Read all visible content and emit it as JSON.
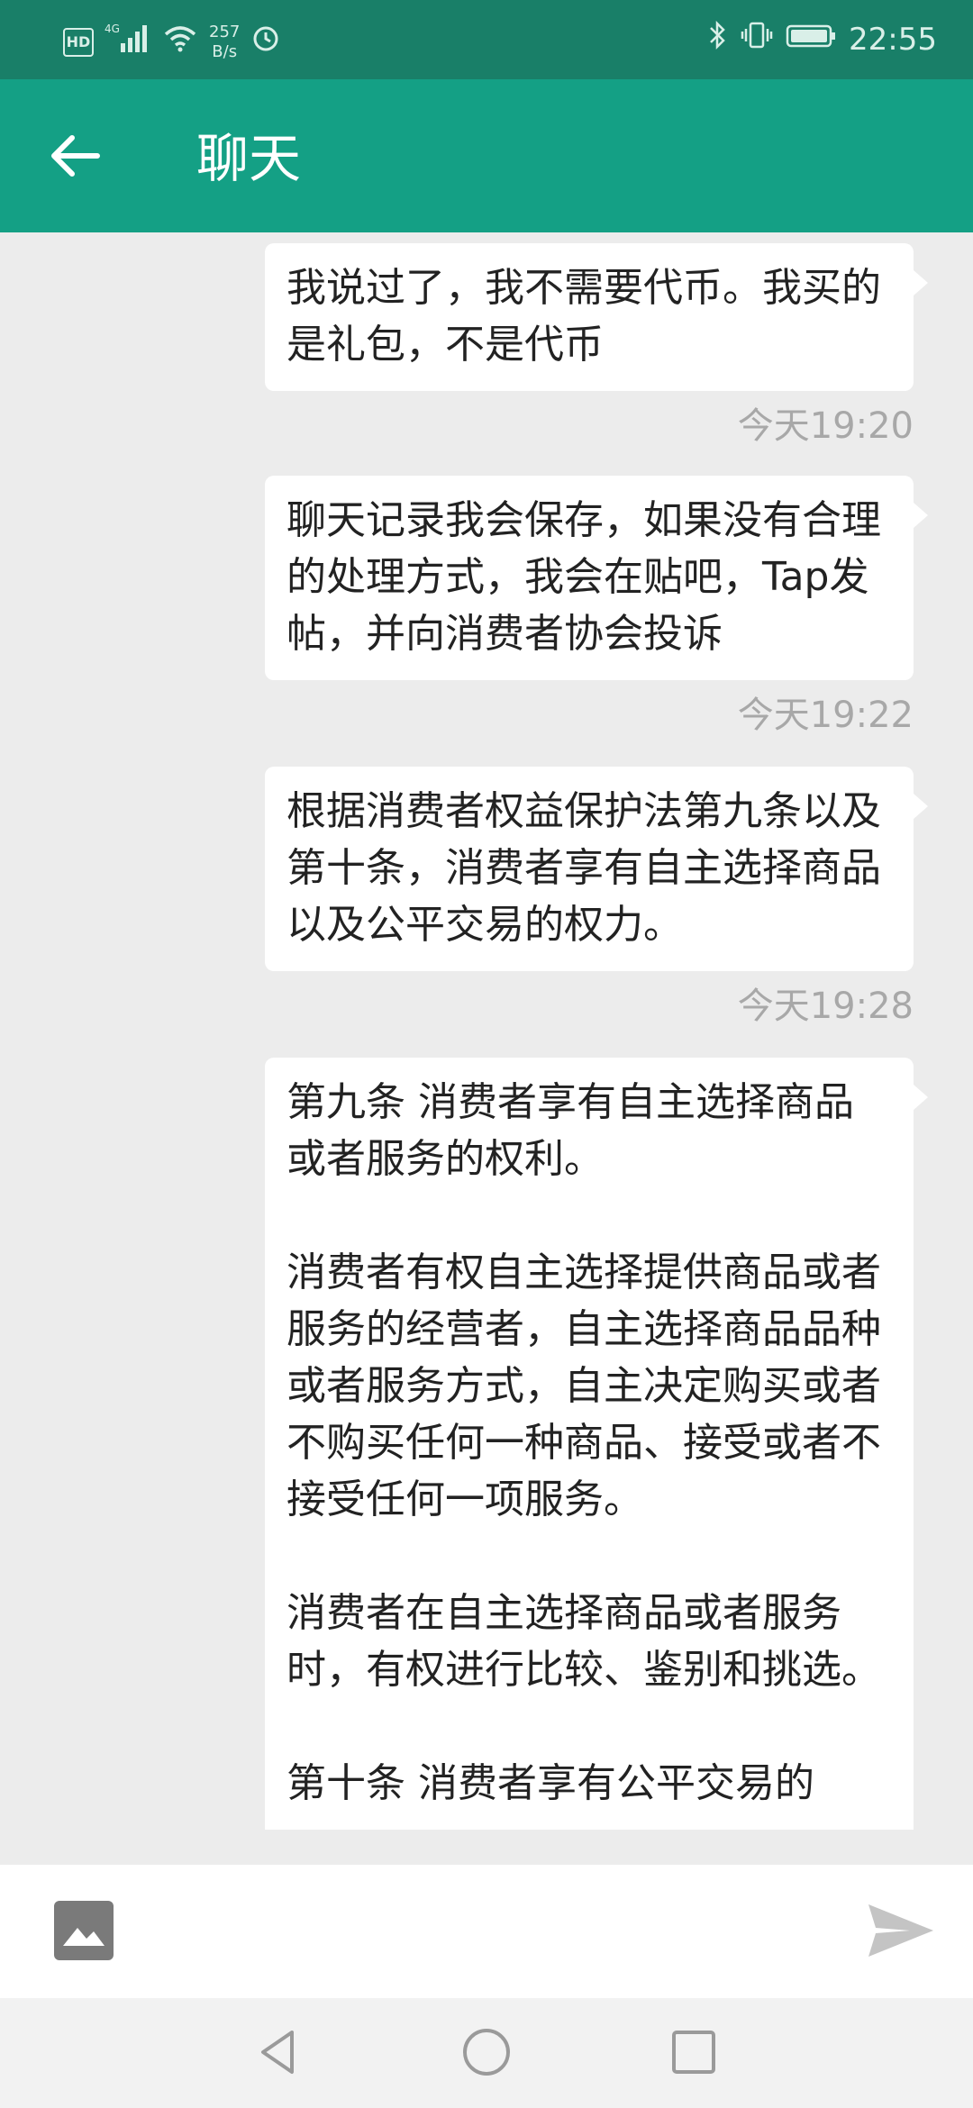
{
  "status_bar": {
    "speed_value": "257",
    "speed_unit": "B/s",
    "network": "4G",
    "time": "22:55"
  },
  "header": {
    "title": "聊天"
  },
  "messages": [
    {
      "text": "我说过了，我不需要代币。我买的是礼包，不是代币",
      "time": "今天19:20"
    },
    {
      "text": "聊天记录我会保存，如果没有合理的处理方式，我会在贴吧，Tap发帖，并向消费者协会投诉",
      "time": "今天19:22"
    },
    {
      "text": "根据消费者权益保护法第九条以及第十条，消费者享有自主选择商品以及公平交易的权力。",
      "time": "今天19:28"
    },
    {
      "text": "第九条 消费者享有自主选择商品或者服务的权利。\n\n消费者有权自主选择提供商品或者服务的经营者，自主选择商品品种或者服务方式，自主决定购买或者不购买任何一种商品、接受或者不接受任何一项服务。\n\n消费者在自主选择商品或者服务时，有权进行比较、鉴别和挑选。\n\n第十条 消费者享有公平交易的"
    }
  ],
  "icons": {
    "back": "arrow-left-icon",
    "image": "image-icon",
    "send": "send-icon",
    "nav_back": "triangle-back-icon",
    "nav_home": "circle-home-icon",
    "nav_recent": "square-recent-icon"
  },
  "colors": {
    "status_bar": "#197f68",
    "app_bar": "#14a085",
    "background": "#ececec",
    "bubble": "#ffffff",
    "timestamp": "#a8a8a8"
  }
}
